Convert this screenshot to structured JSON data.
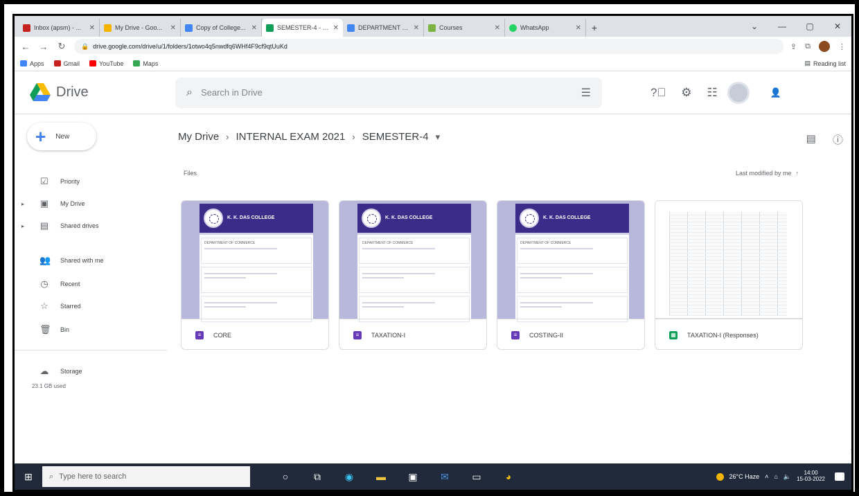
{
  "browser": {
    "tabs": [
      {
        "title": "Inbox (apsm) - ...",
        "color": "#c5221f"
      },
      {
        "title": "My Drive - Goo...",
        "color": "#f4b400"
      },
      {
        "title": "Copy of College...",
        "color": "#4285f4"
      },
      {
        "title": "SEMESTER-4 - G...",
        "color": "#0f9d58",
        "active": true
      },
      {
        "title": "DEPARTMENT O...",
        "color": "#4285f4"
      },
      {
        "title": "Courses",
        "color": "#7cb342"
      },
      {
        "title": "WhatsApp",
        "color": "#25d366"
      }
    ],
    "url": "drive.google.com/drive/u/1/folders/1otwo4q5nwdfq6WHf4F9cf9qtUuKd",
    "bookmarks": [
      {
        "label": "Apps",
        "color": "#4285f4"
      },
      {
        "label": "Gmail",
        "color": "#c5221f"
      },
      {
        "label": "YouTube",
        "color": "#ff0000"
      },
      {
        "label": "Maps",
        "color": "#34a853"
      }
    ],
    "reading_list": "Reading list"
  },
  "drive": {
    "app_name": "Drive",
    "search_placeholder": "Search in Drive",
    "new_label": "New",
    "nav": [
      {
        "label": "Priority",
        "icon": "☑"
      },
      {
        "label": "My Drive",
        "icon": "▣",
        "expand": true
      },
      {
        "label": "Shared drives",
        "icon": "▤",
        "expand": true
      },
      {
        "label": "Shared with me",
        "icon": "👥"
      },
      {
        "label": "Recent",
        "icon": "◷"
      },
      {
        "label": "Starred",
        "icon": "☆"
      },
      {
        "label": "Bin",
        "icon": "🗑"
      },
      {
        "label": "Storage",
        "icon": "☁"
      }
    ],
    "storage_used": "23.1 GB used"
  },
  "breadcrumb": {
    "root": "My Drive",
    "parent": "INTERNAL EXAM 2021",
    "current": "SEMESTER-4"
  },
  "files_label": "Files",
  "sort_label": "Last modified by me",
  "doc_thumb": {
    "college": "K. K. DAS COLLEGE",
    "dept": "DEPARTMENT OF COMMERCE"
  },
  "files": [
    {
      "name": "CORE",
      "icon_color": "#673ab7",
      "kind": "form"
    },
    {
      "name": "TAXATION-I",
      "icon_color": "#673ab7",
      "kind": "form"
    },
    {
      "name": "COSTING-II",
      "icon_color": "#673ab7",
      "kind": "form"
    },
    {
      "name": "TAXATION-I (Responses)",
      "icon_color": "#0f9d58",
      "kind": "sheet"
    }
  ],
  "taskbar": {
    "search_placeholder": "Type here to search",
    "weather": "26°C Haze",
    "time": "14:00",
    "date": "15-03-2022"
  }
}
